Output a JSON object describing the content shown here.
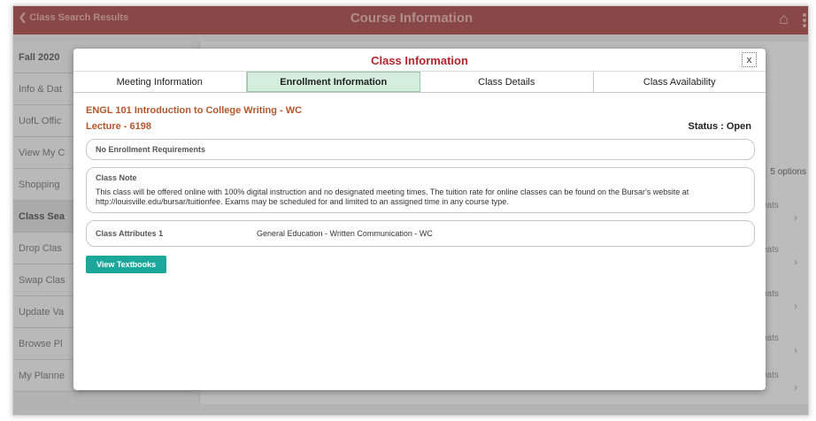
{
  "banner": {
    "back_label": "Class Search Results",
    "title": "Course Information"
  },
  "sidebar": {
    "header": "Fall 2020",
    "items": [
      "Info & Dat",
      "UofL Offic",
      "View My C",
      "Shopping",
      "Class Sea",
      "Drop Clas",
      "Swap Clas",
      "Update Va",
      "Browse Pl",
      "My Planne"
    ]
  },
  "right_panel": {
    "options_label": "5 options",
    "seats_label": "eats"
  },
  "modal": {
    "title": "Class Information",
    "close_label": "x",
    "tabs": [
      "Meeting Information",
      "Enrollment Information",
      "Class Details",
      "Class Availability"
    ],
    "course_title": "ENGL 101 Introduction to College Writing - WC",
    "section": "Lecture - 6198",
    "status": "Status : Open",
    "enrollment_requirements": "No Enrollment Requirements",
    "class_note_title": "Class Note",
    "class_note_text": "This class will be offered online with 100% digital instruction and no designated meeting times.  The tuition rate for online classes can be found on the Bursar's website at http://louisville.edu/bursar/tuitionfee. Exams may be scheduled for and limited to an assigned time in any course type.",
    "attributes_label": "Class Attributes 1",
    "attributes_value": "General Education - Written Communication - WC",
    "textbooks_button": "View Textbooks"
  },
  "colors": {
    "banner": "#a94343",
    "modal_title": "#b3262b",
    "course_text": "#b5562b",
    "active_tab": "#d3eedc",
    "button": "#1ba89a"
  }
}
